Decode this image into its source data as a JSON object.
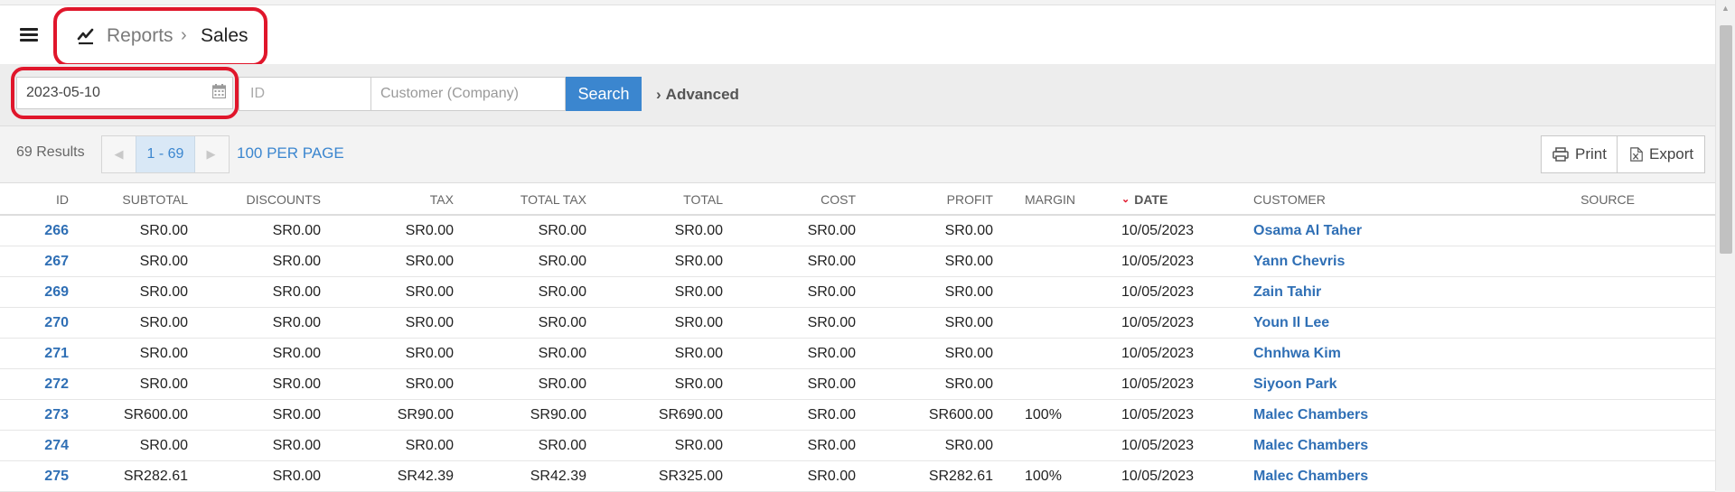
{
  "header": {
    "breadcrumb_parent": "Reports",
    "breadcrumb_separator": "›",
    "breadcrumb_current": "Sales",
    "menu_icon": "hamburger-icon",
    "reports_icon": "chart-line-icon"
  },
  "filters": {
    "date_value": "2023-05-10",
    "id_placeholder": "ID",
    "customer_placeholder": "Customer (Company)",
    "search_label": "Search",
    "advanced_label": "Advanced"
  },
  "results": {
    "count_label": "69 Results",
    "page_range": "1 - 69",
    "per_page_label": "100 PER PAGE",
    "print_label": "Print",
    "export_label": "Export"
  },
  "table": {
    "columns": {
      "id": "ID",
      "subtotal": "SUBTOTAL",
      "discounts": "DISCOUNTS",
      "tax": "TAX",
      "total_tax": "TOTAL TAX",
      "total": "TOTAL",
      "cost": "COST",
      "profit": "PROFIT",
      "margin": "MARGIN",
      "date": "DATE",
      "customer": "CUSTOMER",
      "source": "SOURCE"
    },
    "rows": [
      {
        "id": "266",
        "subtotal": "SR0.00",
        "discounts": "SR0.00",
        "tax": "SR0.00",
        "total_tax": "SR0.00",
        "total": "SR0.00",
        "cost": "SR0.00",
        "profit": "SR0.00",
        "margin": "",
        "date": "10/05/2023",
        "customer": "Osama Al Taher",
        "source": ""
      },
      {
        "id": "267",
        "subtotal": "SR0.00",
        "discounts": "SR0.00",
        "tax": "SR0.00",
        "total_tax": "SR0.00",
        "total": "SR0.00",
        "cost": "SR0.00",
        "profit": "SR0.00",
        "margin": "",
        "date": "10/05/2023",
        "customer": "Yann Chevris",
        "source": ""
      },
      {
        "id": "269",
        "subtotal": "SR0.00",
        "discounts": "SR0.00",
        "tax": "SR0.00",
        "total_tax": "SR0.00",
        "total": "SR0.00",
        "cost": "SR0.00",
        "profit": "SR0.00",
        "margin": "",
        "date": "10/05/2023",
        "customer": "Zain Tahir",
        "source": ""
      },
      {
        "id": "270",
        "subtotal": "SR0.00",
        "discounts": "SR0.00",
        "tax": "SR0.00",
        "total_tax": "SR0.00",
        "total": "SR0.00",
        "cost": "SR0.00",
        "profit": "SR0.00",
        "margin": "",
        "date": "10/05/2023",
        "customer": "Youn Il Lee",
        "source": ""
      },
      {
        "id": "271",
        "subtotal": "SR0.00",
        "discounts": "SR0.00",
        "tax": "SR0.00",
        "total_tax": "SR0.00",
        "total": "SR0.00",
        "cost": "SR0.00",
        "profit": "SR0.00",
        "margin": "",
        "date": "10/05/2023",
        "customer": "Chnhwa Kim",
        "source": ""
      },
      {
        "id": "272",
        "subtotal": "SR0.00",
        "discounts": "SR0.00",
        "tax": "SR0.00",
        "total_tax": "SR0.00",
        "total": "SR0.00",
        "cost": "SR0.00",
        "profit": "SR0.00",
        "margin": "",
        "date": "10/05/2023",
        "customer": "Siyoon Park",
        "source": ""
      },
      {
        "id": "273",
        "subtotal": "SR600.00",
        "discounts": "SR0.00",
        "tax": "SR90.00",
        "total_tax": "SR90.00",
        "total": "SR690.00",
        "cost": "SR0.00",
        "profit": "SR600.00",
        "margin": "100%",
        "date": "10/05/2023",
        "customer": "Malec Chambers",
        "source": ""
      },
      {
        "id": "274",
        "subtotal": "SR0.00",
        "discounts": "SR0.00",
        "tax": "SR0.00",
        "total_tax": "SR0.00",
        "total": "SR0.00",
        "cost": "SR0.00",
        "profit": "SR0.00",
        "margin": "",
        "date": "10/05/2023",
        "customer": "Malec Chambers",
        "source": ""
      },
      {
        "id": "275",
        "subtotal": "SR282.61",
        "discounts": "SR0.00",
        "tax": "SR42.39",
        "total_tax": "SR42.39",
        "total": "SR325.00",
        "cost": "SR0.00",
        "profit": "SR282.61",
        "margin": "100%",
        "date": "10/05/2023",
        "customer": "Malec Chambers",
        "source": ""
      }
    ]
  },
  "colors": {
    "accent": "#3b86cf",
    "highlight": "#e0162b",
    "link": "#2f6fb5"
  }
}
